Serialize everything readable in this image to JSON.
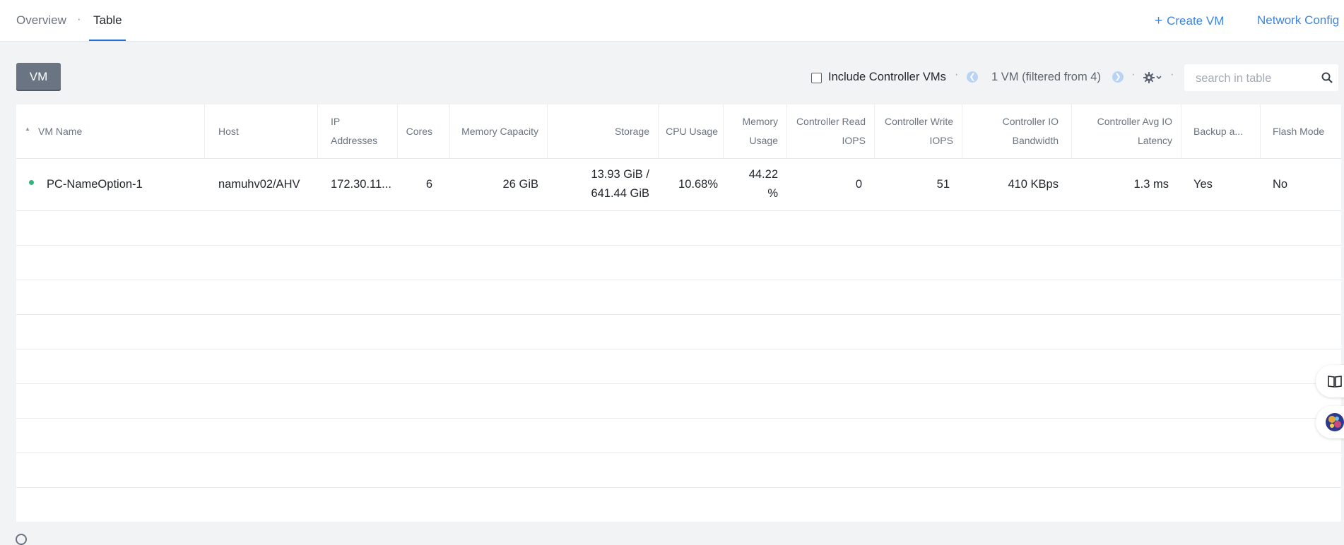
{
  "topbar": {
    "tabs": [
      {
        "label": "Overview",
        "active": false
      },
      {
        "label": "Table",
        "active": true
      }
    ],
    "separator": "·",
    "create_vm": "Create VM",
    "create_vm_icon": "plus-icon",
    "network_config": "Network Config"
  },
  "toolbar": {
    "vm_button": "VM",
    "include_controller_vms": "Include Controller VMs",
    "include_controller_vms_checked": false,
    "page_info": "1 VM (filtered from 4)",
    "prev_icon": "chevron-left-icon",
    "next_icon": "chevron-right-icon",
    "settings_icon": "gear-icon",
    "search_placeholder": "search in table",
    "search_icon": "search-icon",
    "dot": "·"
  },
  "table": {
    "columns": [
      {
        "line1": "VM Name",
        "line2": ""
      },
      {
        "line1": "Host",
        "line2": ""
      },
      {
        "line1": "IP",
        "line2": "Addresses"
      },
      {
        "line1": "Cores",
        "line2": ""
      },
      {
        "line1": "Memory Capacity",
        "line2": ""
      },
      {
        "line1": "Storage",
        "line2": ""
      },
      {
        "line1": "CPU Usage",
        "line2": ""
      },
      {
        "line1": "Memory",
        "line2": "Usage"
      },
      {
        "line1": "Controller Read",
        "line2": "IOPS"
      },
      {
        "line1": "Controller Write",
        "line2": "IOPS"
      },
      {
        "line1": "Controller IO",
        "line2": "Bandwidth"
      },
      {
        "line1": "Controller Avg IO",
        "line2": "Latency"
      },
      {
        "line1": "Backup a...",
        "line2": ""
      },
      {
        "line1": "Flash Mode",
        "line2": ""
      }
    ],
    "rows": [
      {
        "status_color": "#36b37e",
        "vm_name": "PC-NameOption-1",
        "host": "namuhv02/AHV",
        "ip": "172.30.11...",
        "cores": "6",
        "memory_capacity": "26 GiB",
        "storage_line1": "13.93 GiB /",
        "storage_line2": "641.44 GiB",
        "cpu_usage": "10.68%",
        "memory_usage_line1": "44.22",
        "memory_usage_line2": "%",
        "read_iops": "0",
        "write_iops": "51",
        "io_bandwidth": "410 KBps",
        "avg_io_latency": "1.3 ms",
        "backup": "Yes",
        "flash_mode": "No"
      }
    ]
  },
  "side": {
    "docs_icon": "book-icon",
    "assistant_icon": "avatar-icon"
  },
  "colors": {
    "accent": "#3a86e0",
    "active_tab_underline": "#1b6ed6",
    "vm_button": "#6b7482",
    "status_on": "#36b37e"
  }
}
